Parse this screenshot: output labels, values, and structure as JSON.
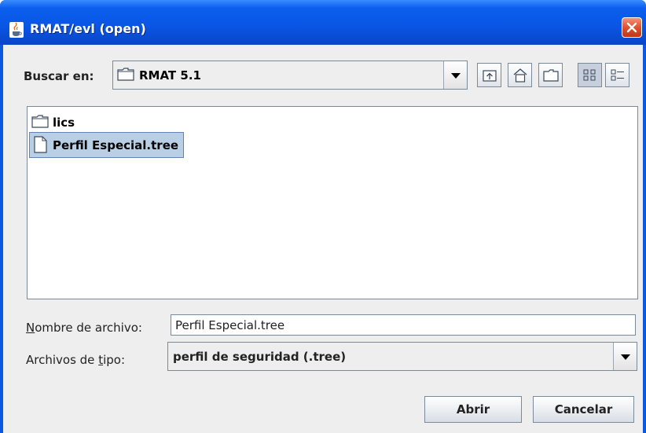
{
  "window": {
    "title": "RMAT/evl (open)"
  },
  "look_in": {
    "label": "Buscar en:",
    "value": "RMAT 5.1"
  },
  "toolbar": {
    "icons": [
      "up-folder-icon",
      "home-icon",
      "new-folder-icon",
      "list-view-icon",
      "details-view-icon"
    ]
  },
  "files": [
    {
      "name": "lics",
      "type": "folder",
      "selected": false
    },
    {
      "name": "Perfil Especial.tree",
      "type": "file",
      "selected": true
    }
  ],
  "filename": {
    "label_prefix": "N",
    "label_rest": "ombre de archivo:",
    "value": "Perfil Especial.tree"
  },
  "filetype": {
    "label_prefix": "Archivos de ",
    "label_mnemonic": "t",
    "label_rest": "ipo:",
    "value": "perfil de seguridad (.tree)"
  },
  "buttons": {
    "open": "Abrir",
    "cancel": "Cancelar"
  },
  "colors": {
    "titlebar": "#0a55e4",
    "selection": "#b8cfe5",
    "close": "#e0502e"
  }
}
